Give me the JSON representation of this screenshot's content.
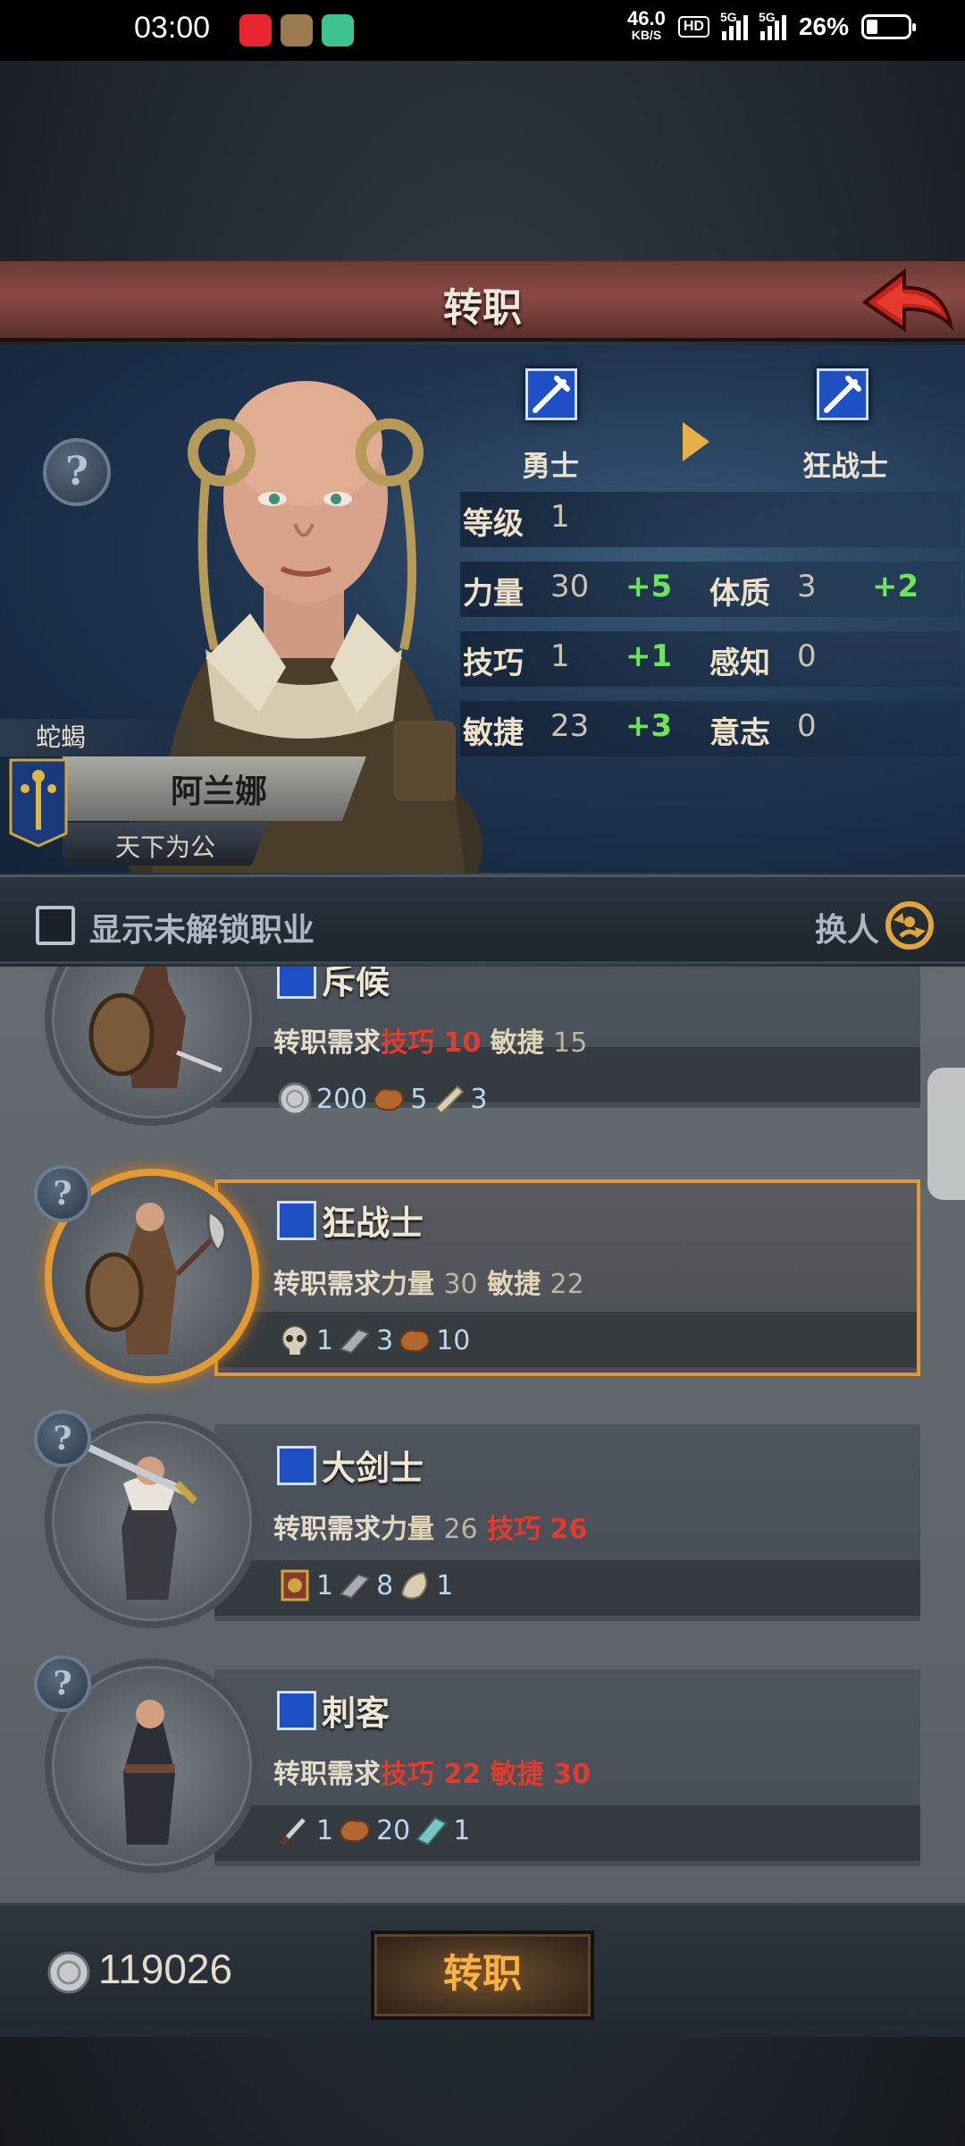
{
  "status_bar": {
    "time": "03:00",
    "net_speed": "46.0",
    "net_unit": "KB/S",
    "hd": "HD",
    "signal_1": "5G",
    "signal_2": "5G",
    "battery_pct": "26%"
  },
  "title": "转职",
  "hero": {
    "faction": "蛇蝎",
    "name": "阿兰娜",
    "motto": "天下为公",
    "current_class": "勇士",
    "target_class": "狂战士"
  },
  "stats": {
    "level_label": "等级",
    "level": "1",
    "str_label": "力量",
    "str": "30",
    "str_plus": "+5",
    "con_label": "体质",
    "con": "3",
    "con_plus": "+2",
    "skill_label": "技巧",
    "skill": "1",
    "skill_plus": "+1",
    "per_label": "感知",
    "per": "0",
    "agi_label": "敏捷",
    "agi": "23",
    "agi_plus": "+3",
    "will_label": "意志",
    "will": "0"
  },
  "toggle": {
    "show_locked": "显示未解锁职业",
    "swap": "换人"
  },
  "jobs": [
    {
      "name": "斥候",
      "req_prefix": "转职需求",
      "req": [
        {
          "label": "技巧",
          "value": "10",
          "met": false
        },
        {
          "label": "敏捷",
          "value": "15",
          "met": true
        }
      ],
      "res": [
        {
          "icon": "silver-coin-icon",
          "qty": "200"
        },
        {
          "icon": "leather-icon",
          "qty": "5"
        },
        {
          "icon": "scroll-icon",
          "qty": "3"
        }
      ]
    },
    {
      "name": "狂战士",
      "selected": true,
      "req_prefix": "转职需求",
      "req": [
        {
          "label": "力量",
          "value": "30",
          "met": true
        },
        {
          "label": "敏捷",
          "value": "22",
          "met": true
        }
      ],
      "res": [
        {
          "icon": "skull-icon",
          "qty": "1"
        },
        {
          "icon": "iron-ingot-icon",
          "qty": "3"
        },
        {
          "icon": "leather-icon",
          "qty": "10"
        }
      ]
    },
    {
      "name": "大剑士",
      "req_prefix": "转职需求",
      "req": [
        {
          "label": "力量",
          "value": "26",
          "met": true
        },
        {
          "label": "技巧",
          "value": "26",
          "met": false
        }
      ],
      "res": [
        {
          "icon": "medal-icon",
          "qty": "1"
        },
        {
          "icon": "iron-ingot-icon",
          "qty": "8"
        },
        {
          "icon": "fur-icon",
          "qty": "1"
        }
      ]
    },
    {
      "name": "刺客",
      "req_prefix": "转职需求",
      "req": [
        {
          "label": "技巧",
          "value": "22",
          "met": false
        },
        {
          "label": "敏捷",
          "value": "30",
          "met": false
        }
      ],
      "res": [
        {
          "icon": "dagger-icon",
          "qty": "1"
        },
        {
          "icon": "leather-icon",
          "qty": "20"
        },
        {
          "icon": "cloth-icon",
          "qty": "1"
        }
      ]
    }
  ],
  "bottom": {
    "gold": "119026",
    "transfer_button": "转职"
  },
  "colors": {
    "accent_orange": "#e49a33",
    "req_unmet": "#e23c2f",
    "stat_bonus": "#6ee45a",
    "class_icon_blue": "#1f4fc4"
  }
}
